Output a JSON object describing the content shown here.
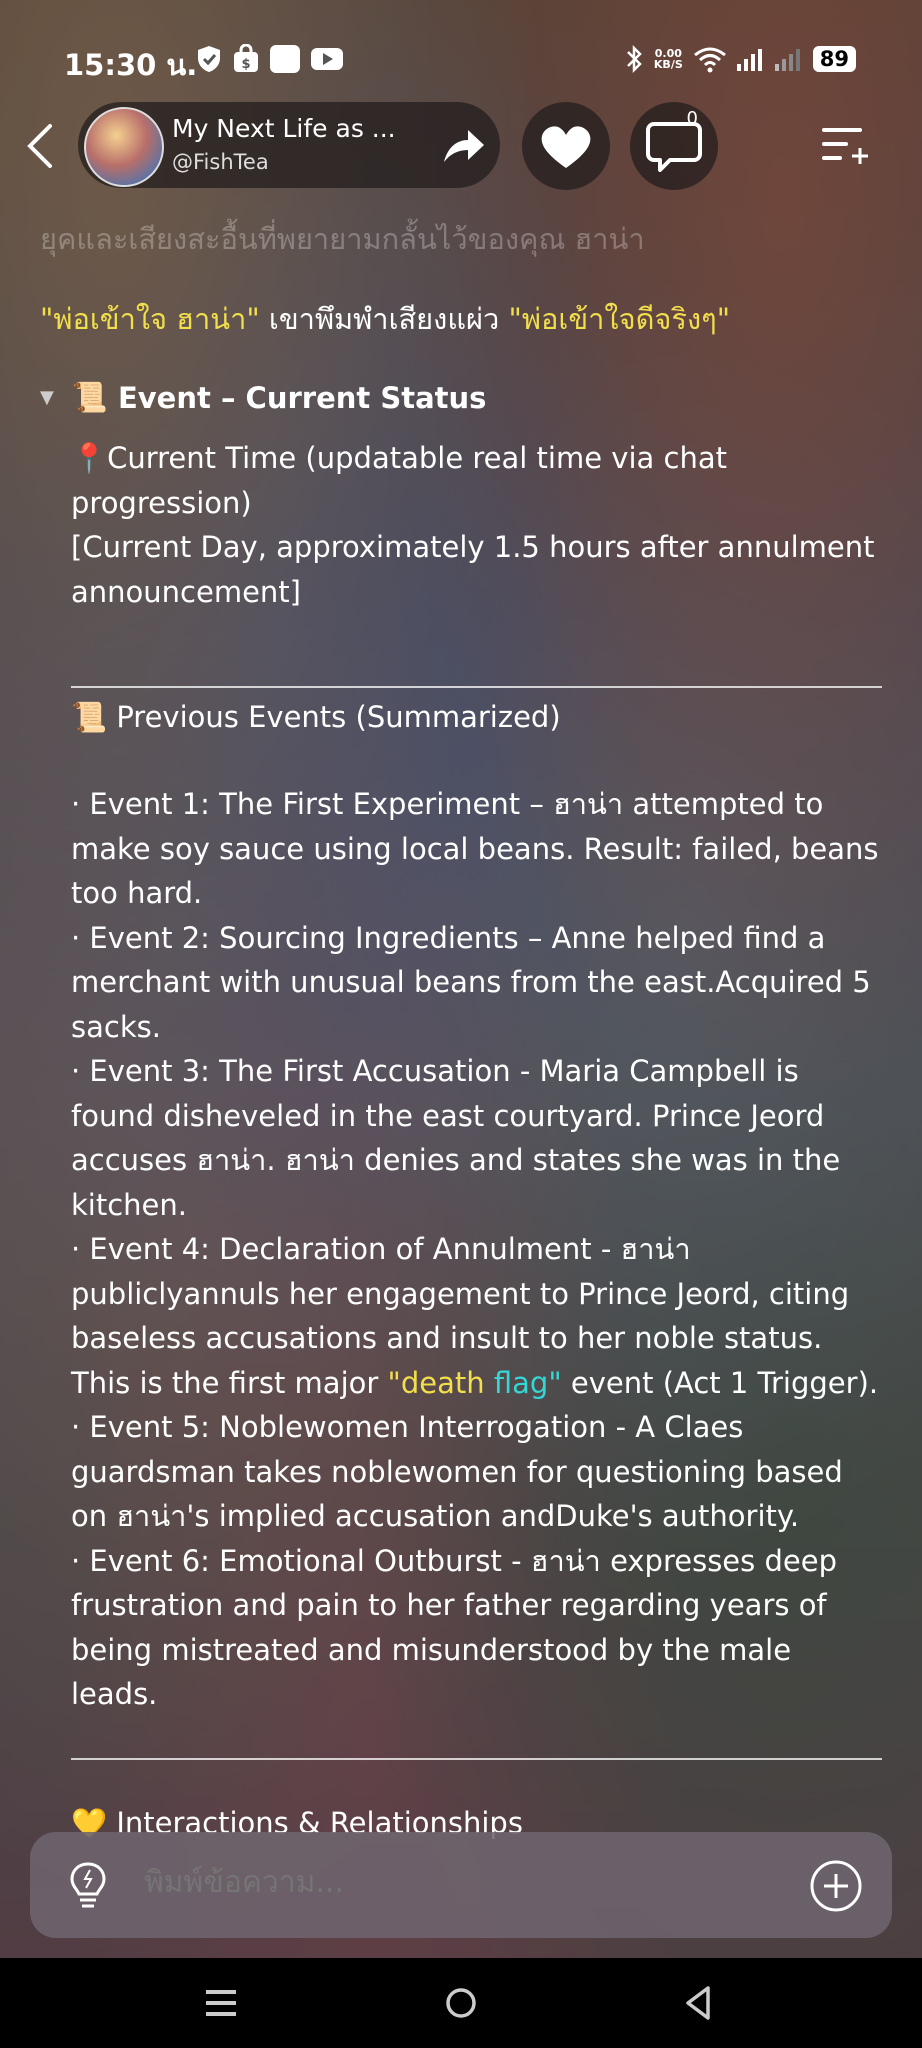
{
  "status_bar": {
    "time": "15:30 น.",
    "network_speed_value": "0.00",
    "network_speed_unit": "KB/S",
    "battery": "89"
  },
  "header": {
    "chat_title": "My Next Life as ...",
    "chat_handle": "@FishTea",
    "comment_count": "0"
  },
  "content": {
    "faded_line": "ยุคและเสียงสะอื้นที่พยายามกลั้นไว้ของคุณ ฮาน่า",
    "quote_open": "\"พ่อเข้าใจ ฮาน่า\"",
    "quote_mid": " เขาพึมพำเสียงแผ่ว ",
    "quote_close": "\"พ่อเข้าใจดีจริงๆ\"",
    "status_summary": "Event  – Current Status",
    "current_time_label": "Current Time (updatable real time via chat progression)",
    "current_day": "[Current Day, approximately 1.5 hours after annulment announcement]",
    "previous_events_title": "Previous Events (Summarized)",
    "events": {
      "e1": "· Event 1: The First Experiment – ฮาน่า attempted to make soy sauce using local beans. Result: failed, beans too hard.",
      "e2": "· Event 2: Sourcing Ingredients – Anne helped find a merchant with unusual beans from the east.Acquired 5 sacks.",
      "e3": "· Event 3: The First Accusation - Maria Campbell is found disheveled in the east courtyard. Prince Jeord accuses ฮาน่า. ฮาน่า denies and states she was in the kitchen.",
      "e4_a": "· Event 4: Declaration of Annulment - ฮาน่า publiclyannuls her engagement to Prince Jeord, citing baseless accusations and insult to her noble status. This is the first major ",
      "e4_q1": "\"death",
      "e4_q2": " flag\"",
      "e4_b": " event (Act 1 Trigger).",
      "e5": "· Event 5: Noblewomen Interrogation - A Claes guardsman takes noblewomen for questioning based on ฮาน่า's implied accusation andDuke's authority.",
      "e6": "· Event 6: Emotional Outburst - ฮาน่า expresses deep frustration and pain to her father regarding years of being mistreated and misunderstood by the male leads."
    },
    "next_section_title": "Interactions & Relationships"
  },
  "input": {
    "placeholder": "พิมพ์ข้อความ..."
  },
  "colors": {
    "accent_yellow": "#f2df4c",
    "accent_cyan": "#35d7d6"
  }
}
